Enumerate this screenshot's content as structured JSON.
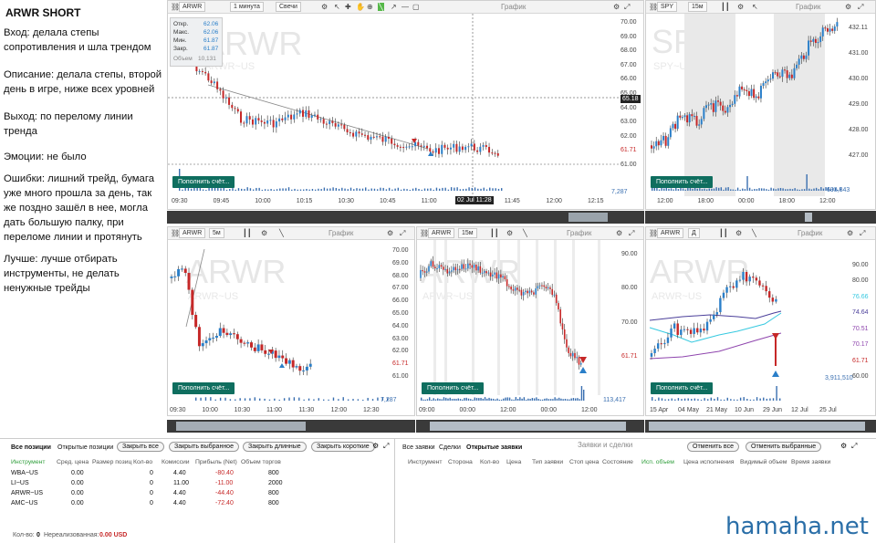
{
  "notes": {
    "title": "ARWR SHORT",
    "entry": "Вход: делала степы сопротивления и шла трендом",
    "description": "Описание: делала степы, второй день в игре, ниже всех уровней",
    "exit": "Выход: по перелому линии тренда",
    "emotions": "Эмоции: не было",
    "mistakes": "Ошибки: лишний трейд, бумага уже много прошла за день, так же поздно зашёл в нее, могла дать большую палку, при переломе линии и протянуть",
    "better": "Лучше: лучше отбирать инструменты, не делать ненужные трейды"
  },
  "common": {
    "chart_label": "График",
    "fill_button": "Пополнить счёт...",
    "candles": "Свечи"
  },
  "w1": {
    "symbol": "ARWR",
    "interval": "1 минута",
    "watermark": "ARWR",
    "watermark_sub": "ARWR~US",
    "ohlc": {
      "open_l": "Откр.",
      "open_v": "62.06",
      "high_l": "Макс.",
      "high_v": "62.06",
      "low_l": "Мин.",
      "low_v": "61.87",
      "close_l": "Закр.",
      "close_v": "61.87",
      "vol_l": "Объем",
      "vol_v": "10,131"
    },
    "yticks": [
      "70.00",
      "69.00",
      "68.00",
      "67.00",
      "66.00",
      "65.00",
      "64.00",
      "63.00",
      "62.00",
      "61.71",
      "61.00"
    ],
    "price_tag": "65.18",
    "xticks": [
      "09:30",
      "09:45",
      "10:00",
      "10:15",
      "10:30",
      "10:45",
      "11:00",
      "11:15",
      "11:45",
      "12:00",
      "12:15"
    ],
    "cursor_time": "02 Jul 11:28",
    "volume": "7,287"
  },
  "w2": {
    "symbol": "SPY",
    "interval": "15м",
    "watermark": "SPY",
    "watermark_sub": "SPY~US",
    "yticks": [
      "432.11",
      "431.00",
      "430.00",
      "429.00",
      "428.00",
      "427.00"
    ],
    "xticks": [
      "12:00",
      "18:00",
      "00:00",
      "18:00",
      "12:00"
    ],
    "volume": "693,343"
  },
  "w3": {
    "symbol": "ARWR",
    "interval": "5м",
    "watermark": "ARWR",
    "watermark_sub": "ARWR~US",
    "yticks": [
      "70.00",
      "69.00",
      "68.00",
      "67.00",
      "66.00",
      "65.00",
      "64.00",
      "63.00",
      "62.00",
      "61.71",
      "61.00"
    ],
    "xticks": [
      "09:30",
      "10:00",
      "10:30",
      "11:00",
      "11:30",
      "12:00",
      "12:30"
    ],
    "volume": "7,287"
  },
  "w4": {
    "symbol": "ARWR",
    "interval": "15м",
    "watermark": "ARWR",
    "watermark_sub": "ARWR~US",
    "yticks": [
      "90.00",
      "80.00",
      "70.00",
      "61.71"
    ],
    "xticks": [
      "09:00",
      "00:00",
      "12:00",
      "00:00",
      "12:00"
    ],
    "volume": "113,417"
  },
  "w5": {
    "symbol": "ARWR",
    "interval": "Д",
    "watermark": "ARWR",
    "watermark_sub": "ARWR~US",
    "yticks": [
      "90.00",
      "80.00",
      "76.66",
      "74.64",
      "70.51",
      "70.17",
      "61.71",
      "60.00"
    ],
    "xticks": [
      "15 Apr",
      "04 May",
      "21 May",
      "10 Jun",
      "29 Jun",
      "12 Jul",
      "25 Jul"
    ],
    "volume": "3,911,510"
  },
  "positions": {
    "tab_all": "Все позиции",
    "tab_open": "Открытые позиции",
    "btn_close_all": "Закрыть все",
    "btn_close_selected": "Закрыть выбранное",
    "btn_close_long": "Закрыть длинные",
    "btn_close_short": "Закрыть короткие",
    "headers": [
      "Инструмент",
      "Сред. цена",
      "Размер позиц",
      "Кол-во",
      "Комиссии",
      "Прибыль (Net)",
      "Объем торгов"
    ],
    "rows": [
      {
        "sym": "WBA~US",
        "avg": "0.00",
        "qty": "0",
        "comm": "4.40",
        "pnl": "-80.40",
        "vol": "800"
      },
      {
        "sym": "LI~US",
        "avg": "0.00",
        "qty": "0",
        "comm": "11.00",
        "pnl": "-11.00",
        "vol": "2000"
      },
      {
        "sym": "ARWR~US",
        "avg": "0.00",
        "qty": "0",
        "comm": "4.40",
        "pnl": "-44.40",
        "vol": "800"
      },
      {
        "sym": "AMC~US",
        "avg": "0.00",
        "qty": "0",
        "comm": "4.40",
        "pnl": "-72.40",
        "vol": "800"
      }
    ],
    "footer_qty_l": "Кол-во:",
    "footer_qty_v": "0",
    "footer_unreal_l": "Нереализованная:",
    "footer_unreal_v": "0.00 USD"
  },
  "orders": {
    "title": "Заявки и сделки",
    "tab_all": "Все заявки",
    "tab_deals": "Сделки",
    "tab_open": "Открытые заявки",
    "btn_cancel_all": "Отменить все",
    "btn_cancel_selected": "Отменить выбранные",
    "headers": [
      "Инструмент",
      "Сторона",
      "Кол-во",
      "Цена",
      "Тип заявки",
      "Стоп цена",
      "Состояние",
      "Исп. объем",
      "Цена исполнения",
      "Видимый объем",
      "Время заявки"
    ]
  },
  "brand": "hamaha.net",
  "colors": {
    "up": "#2a7fc9",
    "down": "#c62828",
    "accent": "#0f6e5f"
  }
}
